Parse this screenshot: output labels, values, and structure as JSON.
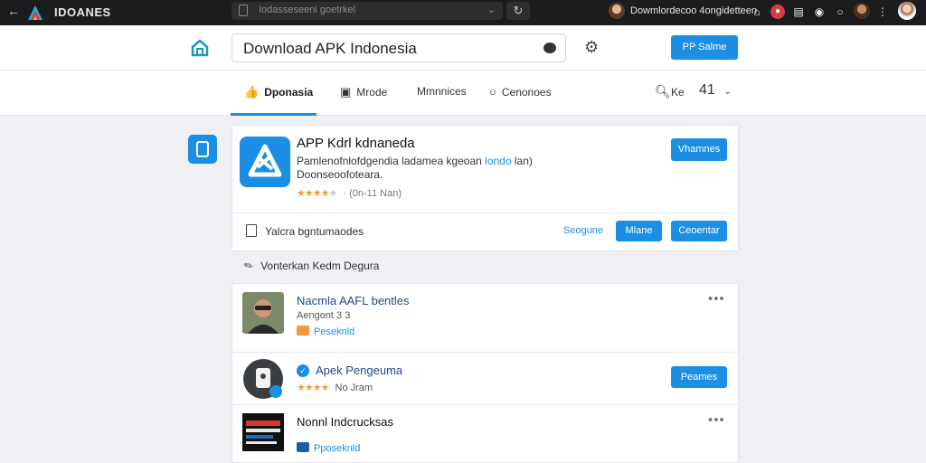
{
  "topbar": {
    "brand": "IDOANES",
    "url": "Iodasseseeni goetrkel",
    "profile_name": "Dowmlordecoo 4ongidetteen",
    "icons": [
      "back-arrow-icon",
      "home-icon",
      "notification-icon",
      "document-icon",
      "circle-icon",
      "circle-icon",
      "menu-dots-icon"
    ]
  },
  "header": {
    "search_value": "Download APK Indonesia",
    "cta_label": "PP Salme"
  },
  "tabs": {
    "items": [
      {
        "icon": "thumbs-up-icon",
        "label": "Dponasia"
      },
      {
        "icon": "square-icon",
        "label": "Mrode"
      },
      {
        "icon": "",
        "label": "Mmnnices"
      },
      {
        "icon": "circle-icon",
        "label": "Cenonoes"
      }
    ],
    "right_label": "Ke",
    "right_number": "41"
  },
  "app_card": {
    "title": "APP Kdrl kdnaneda",
    "desc_line1": "Pamlenofnlofdgendia ladamea kgeoan ",
    "desc_link": "londo",
    "desc_line1_end": " lan)",
    "desc_line2": "Doonseoofoteara.",
    "rating_count": "(0n-11 Nan)",
    "install_label": "Vhamnes",
    "footer_label": "Yalcra bgntumaodes",
    "text_button": "Seogune",
    "button_1": "Mlane",
    "button_2": "Ceoentar"
  },
  "section": {
    "label": "Vonterkan Kedm Degura"
  },
  "list": {
    "rows": [
      {
        "title": "Nacmla AAFL bentles",
        "sub": "Aengont 3 3",
        "tag": "Peseknld",
        "action": "more"
      },
      {
        "title": "Apek Pengeuma",
        "sub": "No Jram",
        "action_label": "Peames"
      },
      {
        "title": "Nonnl Indcrucksas",
        "tag": "Pposeknld",
        "action": "more"
      }
    ]
  },
  "colors": {
    "accent": "#1a8fe3",
    "topbar": "#1c1c1e",
    "star": "#e6a53c"
  }
}
